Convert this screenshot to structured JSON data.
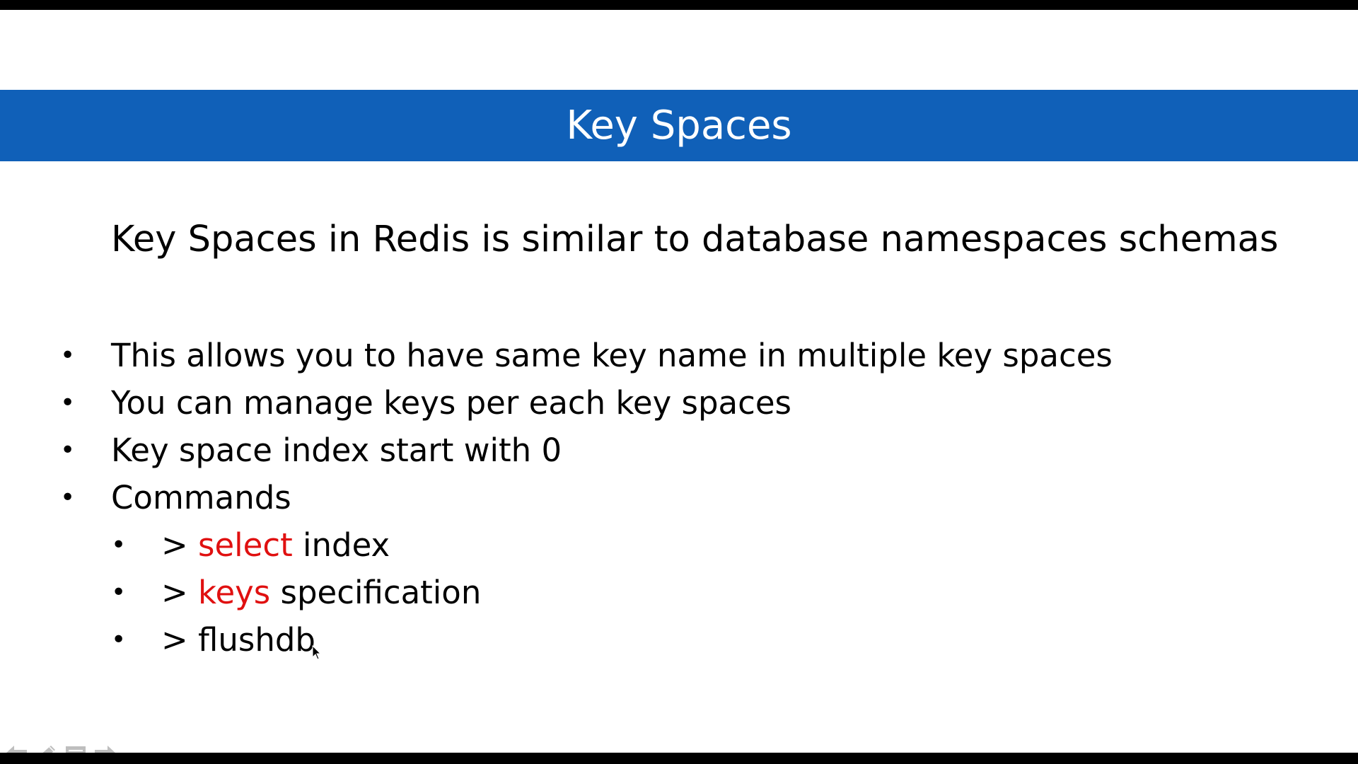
{
  "slide": {
    "title": "Key Spaces",
    "intro": "Key Spaces in Redis is similar to database namespaces schemas",
    "bullet_symbol": "•",
    "bullets": [
      {
        "text": "This allows you to have same key name in multiple key spaces"
      },
      {
        "text": "You can manage keys per each key spaces"
      },
      {
        "text": "Key space index start with 0"
      },
      {
        "text": "Commands"
      }
    ],
    "commands": [
      {
        "prefix": "> ",
        "keyword": "select",
        "rest": " index"
      },
      {
        "prefix": "> ",
        "keyword": "keys",
        "rest": " specification"
      },
      {
        "prefix": "> ",
        "keyword": "",
        "rest": "flushdb"
      }
    ]
  },
  "colors": {
    "title_bar": "#1060b8",
    "keyword": "#e01010"
  },
  "controls": {
    "icons": [
      "arrow-left-icon",
      "pen-icon",
      "menu-icon",
      "arrow-right-icon"
    ]
  }
}
